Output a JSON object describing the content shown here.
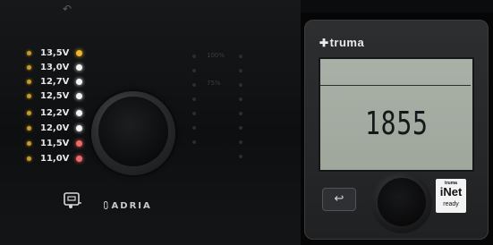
{
  "adria": {
    "voltages": [
      {
        "label": "13,5V",
        "led": "amber"
      },
      {
        "label": "13,0V",
        "led": "white"
      },
      {
        "label": "12,7V",
        "led": "white"
      },
      {
        "label": "12,5V",
        "led": "white"
      },
      {
        "label": "12,2V",
        "led": "white"
      },
      {
        "label": "12,0V",
        "led": "white"
      },
      {
        "label": "11,5V",
        "led": "red"
      },
      {
        "label": "11,0V",
        "led": "red"
      }
    ],
    "level_marks": {
      "top": "100%",
      "mid": "75%"
    },
    "logo": "ADRIA",
    "icons": {
      "back": "back-arrow-icon",
      "caravan": "caravan-icon",
      "logo_mark": "adria-logo-icon"
    }
  },
  "truma": {
    "logo": "truma",
    "display_value": "1855",
    "back_symbol": "↩",
    "inet": {
      "brand": "truma",
      "name": "iNet",
      "tag": "ready"
    }
  },
  "colors": {
    "led_amber": "#f2b730",
    "led_white": "#f4f4f4",
    "led_red": "#f06a6a",
    "lcd": "#a9b0a7"
  }
}
